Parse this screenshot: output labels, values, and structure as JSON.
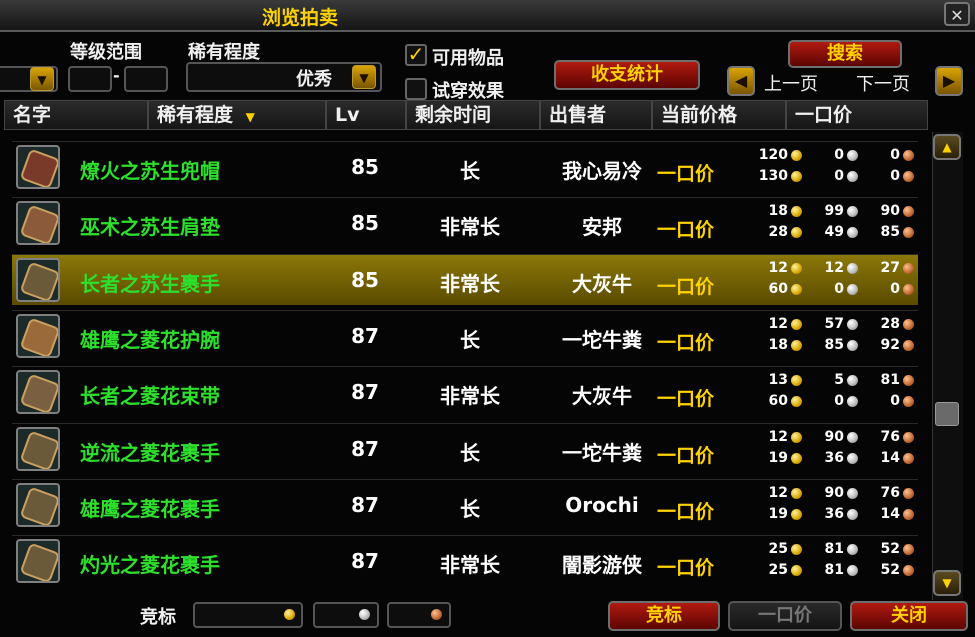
{
  "window": {
    "title": "浏览拍卖"
  },
  "filters": {
    "level_range_label": "等级范围",
    "level_separator": "-",
    "rarity_label": "稀有程度",
    "rarity_value": "优秀",
    "usable_items_label": "可用物品",
    "usable_items_checked": true,
    "preview_label": "试穿效果",
    "preview_checked": false
  },
  "buttons": {
    "stats": "收支统计",
    "search": "搜索",
    "prev_page": "上一页",
    "next_page": "下一页",
    "bid": "竞标",
    "buyout": "一口价",
    "close": "关闭"
  },
  "columns": {
    "name": "名字",
    "rarity": "稀有程度",
    "level": "Lv",
    "time_left": "剩余时间",
    "seller": "出售者",
    "current_price": "当前价格",
    "buyout": "一口价"
  },
  "rows": [
    {
      "name": "燎火之苏生兜帽",
      "level": "85",
      "time": "长",
      "seller": "我心易冷",
      "buyout_label": "一口价",
      "selected": false,
      "icon": "helm-icon",
      "bid": {
        "g": "120",
        "s": "0",
        "c": "0"
      },
      "buy": {
        "g": "130",
        "s": "0",
        "c": "0"
      }
    },
    {
      "name": "巫术之苏生肩垫",
      "level": "85",
      "time": "非常长",
      "seller": "安邦",
      "buyout_label": "一口价",
      "selected": false,
      "icon": "shoulder-icon",
      "bid": {
        "g": "18",
        "s": "99",
        "c": "90"
      },
      "buy": {
        "g": "28",
        "s": "49",
        "c": "85"
      }
    },
    {
      "name": "长者之苏生裹手",
      "level": "85",
      "time": "非常长",
      "seller": "大灰牛",
      "buyout_label": "一口价",
      "selected": true,
      "icon": "gloves-icon",
      "bid": {
        "g": "12",
        "s": "12",
        "c": "27"
      },
      "buy": {
        "g": "60",
        "s": "0",
        "c": "0"
      }
    },
    {
      "name": "雄鹰之菱花护腕",
      "level": "87",
      "time": "长",
      "seller": "一坨牛粪",
      "buyout_label": "一口价",
      "selected": false,
      "icon": "bracer-icon",
      "bid": {
        "g": "12",
        "s": "57",
        "c": "28"
      },
      "buy": {
        "g": "18",
        "s": "85",
        "c": "92"
      }
    },
    {
      "name": "长者之菱花束带",
      "level": "87",
      "time": "非常长",
      "seller": "大灰牛",
      "buyout_label": "一口价",
      "selected": false,
      "icon": "belt-icon",
      "bid": {
        "g": "13",
        "s": "5",
        "c": "81"
      },
      "buy": {
        "g": "60",
        "s": "0",
        "c": "0"
      }
    },
    {
      "name": "逆流之菱花裹手",
      "level": "87",
      "time": "长",
      "seller": "一坨牛粪",
      "buyout_label": "一口价",
      "selected": false,
      "icon": "gloves-icon",
      "bid": {
        "g": "12",
        "s": "90",
        "c": "76"
      },
      "buy": {
        "g": "19",
        "s": "36",
        "c": "14"
      }
    },
    {
      "name": "雄鹰之菱花裹手",
      "level": "87",
      "time": "长",
      "seller": "Orochi",
      "buyout_label": "一口价",
      "selected": false,
      "icon": "gloves-icon",
      "bid": {
        "g": "12",
        "s": "90",
        "c": "76"
      },
      "buy": {
        "g": "19",
        "s": "36",
        "c": "14"
      }
    },
    {
      "name": "灼光之菱花裹手",
      "level": "87",
      "time": "非常长",
      "seller": "闇影游侠",
      "buyout_label": "一口价",
      "selected": false,
      "icon": "gloves-icon",
      "bid": {
        "g": "25",
        "s": "81",
        "c": "52"
      },
      "buy": {
        "g": "25",
        "s": "81",
        "c": "52"
      }
    }
  ],
  "bid_bar": {
    "label": "竞标"
  },
  "colors": {
    "item_name": "#2ce02c",
    "accent": "#ffd200",
    "selected_row": "#8c7808"
  }
}
